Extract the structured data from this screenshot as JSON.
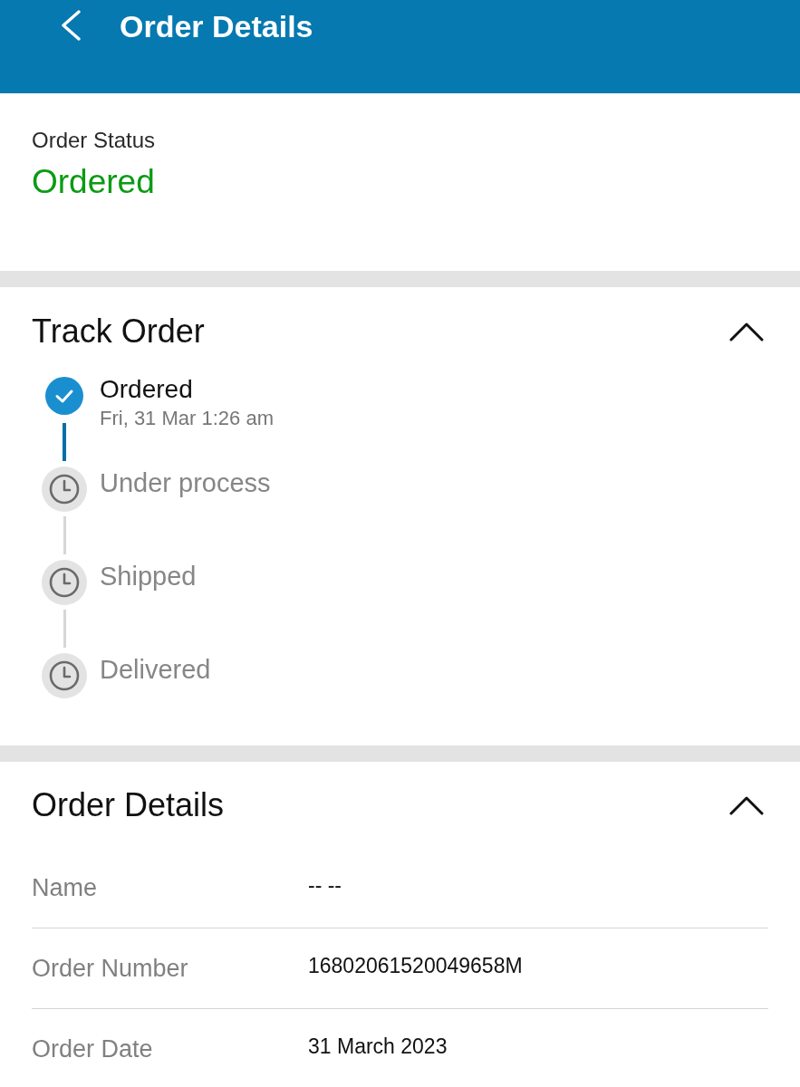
{
  "header": {
    "title": "Order Details"
  },
  "status": {
    "label": "Order Status",
    "value": "Ordered"
  },
  "track": {
    "title": "Track Order",
    "expanded": true,
    "steps": [
      {
        "label": "Ordered",
        "time": "Fri, 31 Mar 1:26 am",
        "done": true
      },
      {
        "label": "Under process",
        "done": false
      },
      {
        "label": "Shipped",
        "done": false
      },
      {
        "label": "Delivered",
        "done": false
      }
    ]
  },
  "details": {
    "title": "Order Details",
    "expanded": true,
    "rows": [
      {
        "label": "Name",
        "value": "-- --"
      },
      {
        "label": "Order Number",
        "value": "16802061520049658M"
      },
      {
        "label": "Order Date",
        "value": "31 March 2023"
      }
    ]
  }
}
